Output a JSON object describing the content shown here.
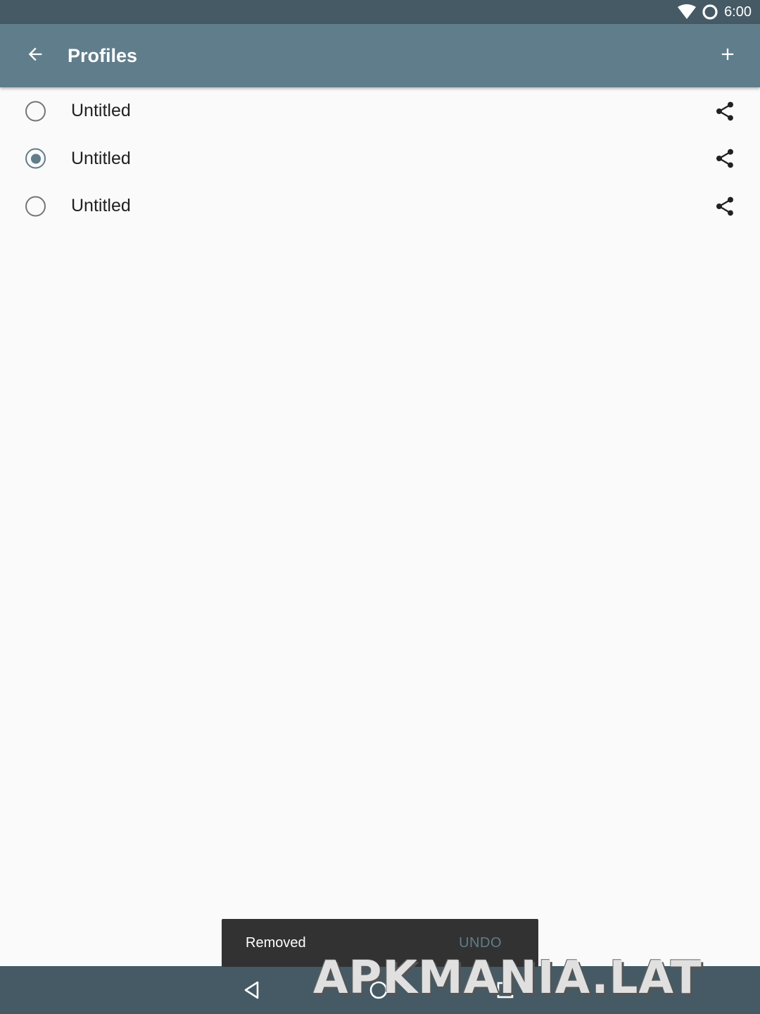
{
  "status_bar": {
    "time": "6:00",
    "icons": [
      "wifi-icon",
      "sync-circle-icon"
    ]
  },
  "app_bar": {
    "title": "Profiles",
    "back_icon": "arrow-back-icon",
    "add_icon": "plus-icon"
  },
  "profiles": [
    {
      "name": "Untitled",
      "selected": false,
      "share_icon": "share-icon"
    },
    {
      "name": "Untitled",
      "selected": true,
      "share_icon": "share-icon"
    },
    {
      "name": "Untitled",
      "selected": false,
      "share_icon": "share-icon"
    }
  ],
  "snackbar": {
    "message": "Removed",
    "action": "UNDO"
  },
  "nav_bar": {
    "icons": [
      "nav-back-icon",
      "nav-home-icon",
      "nav-recents-icon"
    ]
  },
  "watermark": "APKMANIA.LAT",
  "colors": {
    "primary": "#607d8b",
    "primary_dark": "#455a64",
    "background": "#fafafa",
    "snackbar": "#323232"
  }
}
